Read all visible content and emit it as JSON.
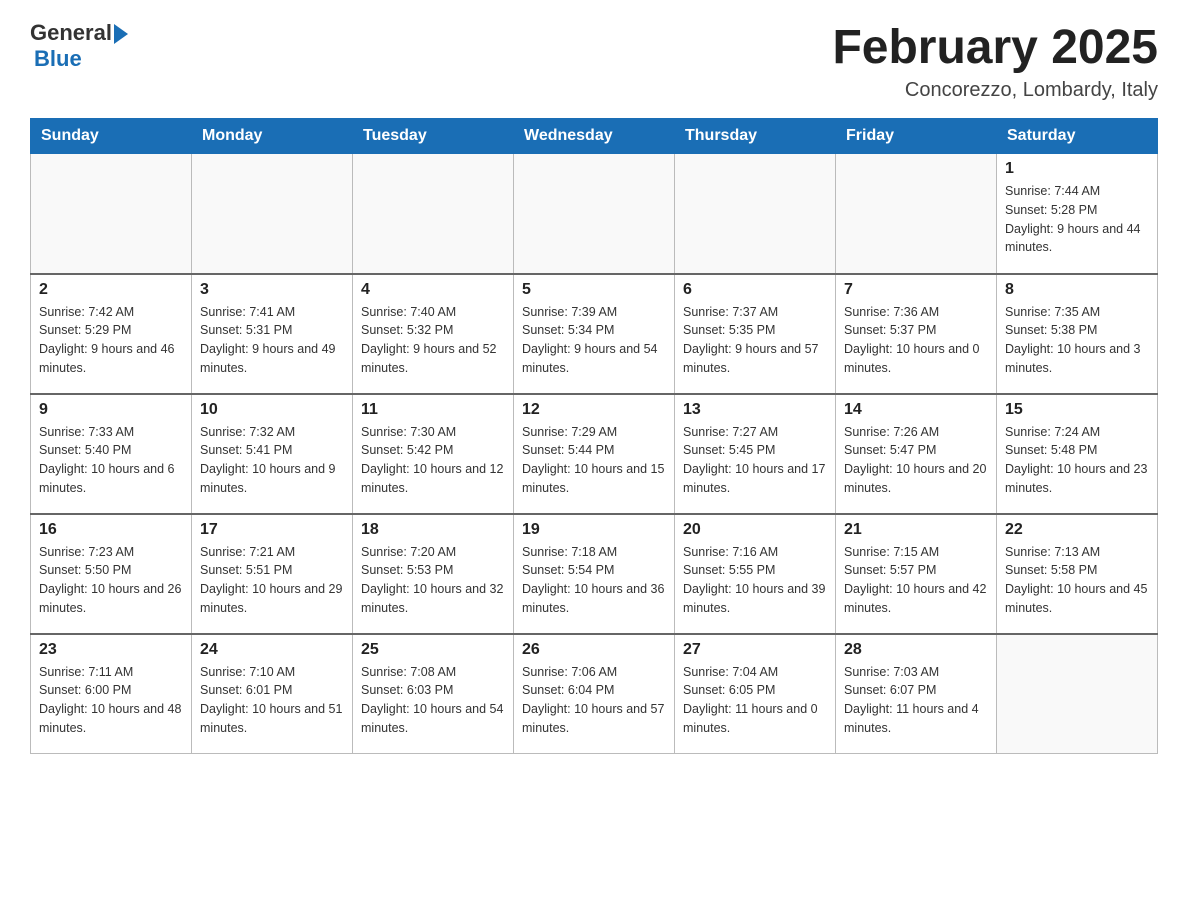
{
  "header": {
    "logo_general": "General",
    "logo_blue": "Blue",
    "month_title": "February 2025",
    "location": "Concorezzo, Lombardy, Italy"
  },
  "weekdays": [
    "Sunday",
    "Monday",
    "Tuesday",
    "Wednesday",
    "Thursday",
    "Friday",
    "Saturday"
  ],
  "weeks": [
    [
      {
        "day": "",
        "info": ""
      },
      {
        "day": "",
        "info": ""
      },
      {
        "day": "",
        "info": ""
      },
      {
        "day": "",
        "info": ""
      },
      {
        "day": "",
        "info": ""
      },
      {
        "day": "",
        "info": ""
      },
      {
        "day": "1",
        "info": "Sunrise: 7:44 AM\nSunset: 5:28 PM\nDaylight: 9 hours and 44 minutes."
      }
    ],
    [
      {
        "day": "2",
        "info": "Sunrise: 7:42 AM\nSunset: 5:29 PM\nDaylight: 9 hours and 46 minutes."
      },
      {
        "day": "3",
        "info": "Sunrise: 7:41 AM\nSunset: 5:31 PM\nDaylight: 9 hours and 49 minutes."
      },
      {
        "day": "4",
        "info": "Sunrise: 7:40 AM\nSunset: 5:32 PM\nDaylight: 9 hours and 52 minutes."
      },
      {
        "day": "5",
        "info": "Sunrise: 7:39 AM\nSunset: 5:34 PM\nDaylight: 9 hours and 54 minutes."
      },
      {
        "day": "6",
        "info": "Sunrise: 7:37 AM\nSunset: 5:35 PM\nDaylight: 9 hours and 57 minutes."
      },
      {
        "day": "7",
        "info": "Sunrise: 7:36 AM\nSunset: 5:37 PM\nDaylight: 10 hours and 0 minutes."
      },
      {
        "day": "8",
        "info": "Sunrise: 7:35 AM\nSunset: 5:38 PM\nDaylight: 10 hours and 3 minutes."
      }
    ],
    [
      {
        "day": "9",
        "info": "Sunrise: 7:33 AM\nSunset: 5:40 PM\nDaylight: 10 hours and 6 minutes."
      },
      {
        "day": "10",
        "info": "Sunrise: 7:32 AM\nSunset: 5:41 PM\nDaylight: 10 hours and 9 minutes."
      },
      {
        "day": "11",
        "info": "Sunrise: 7:30 AM\nSunset: 5:42 PM\nDaylight: 10 hours and 12 minutes."
      },
      {
        "day": "12",
        "info": "Sunrise: 7:29 AM\nSunset: 5:44 PM\nDaylight: 10 hours and 15 minutes."
      },
      {
        "day": "13",
        "info": "Sunrise: 7:27 AM\nSunset: 5:45 PM\nDaylight: 10 hours and 17 minutes."
      },
      {
        "day": "14",
        "info": "Sunrise: 7:26 AM\nSunset: 5:47 PM\nDaylight: 10 hours and 20 minutes."
      },
      {
        "day": "15",
        "info": "Sunrise: 7:24 AM\nSunset: 5:48 PM\nDaylight: 10 hours and 23 minutes."
      }
    ],
    [
      {
        "day": "16",
        "info": "Sunrise: 7:23 AM\nSunset: 5:50 PM\nDaylight: 10 hours and 26 minutes."
      },
      {
        "day": "17",
        "info": "Sunrise: 7:21 AM\nSunset: 5:51 PM\nDaylight: 10 hours and 29 minutes."
      },
      {
        "day": "18",
        "info": "Sunrise: 7:20 AM\nSunset: 5:53 PM\nDaylight: 10 hours and 32 minutes."
      },
      {
        "day": "19",
        "info": "Sunrise: 7:18 AM\nSunset: 5:54 PM\nDaylight: 10 hours and 36 minutes."
      },
      {
        "day": "20",
        "info": "Sunrise: 7:16 AM\nSunset: 5:55 PM\nDaylight: 10 hours and 39 minutes."
      },
      {
        "day": "21",
        "info": "Sunrise: 7:15 AM\nSunset: 5:57 PM\nDaylight: 10 hours and 42 minutes."
      },
      {
        "day": "22",
        "info": "Sunrise: 7:13 AM\nSunset: 5:58 PM\nDaylight: 10 hours and 45 minutes."
      }
    ],
    [
      {
        "day": "23",
        "info": "Sunrise: 7:11 AM\nSunset: 6:00 PM\nDaylight: 10 hours and 48 minutes."
      },
      {
        "day": "24",
        "info": "Sunrise: 7:10 AM\nSunset: 6:01 PM\nDaylight: 10 hours and 51 minutes."
      },
      {
        "day": "25",
        "info": "Sunrise: 7:08 AM\nSunset: 6:03 PM\nDaylight: 10 hours and 54 minutes."
      },
      {
        "day": "26",
        "info": "Sunrise: 7:06 AM\nSunset: 6:04 PM\nDaylight: 10 hours and 57 minutes."
      },
      {
        "day": "27",
        "info": "Sunrise: 7:04 AM\nSunset: 6:05 PM\nDaylight: 11 hours and 0 minutes."
      },
      {
        "day": "28",
        "info": "Sunrise: 7:03 AM\nSunset: 6:07 PM\nDaylight: 11 hours and 4 minutes."
      },
      {
        "day": "",
        "info": ""
      }
    ]
  ]
}
